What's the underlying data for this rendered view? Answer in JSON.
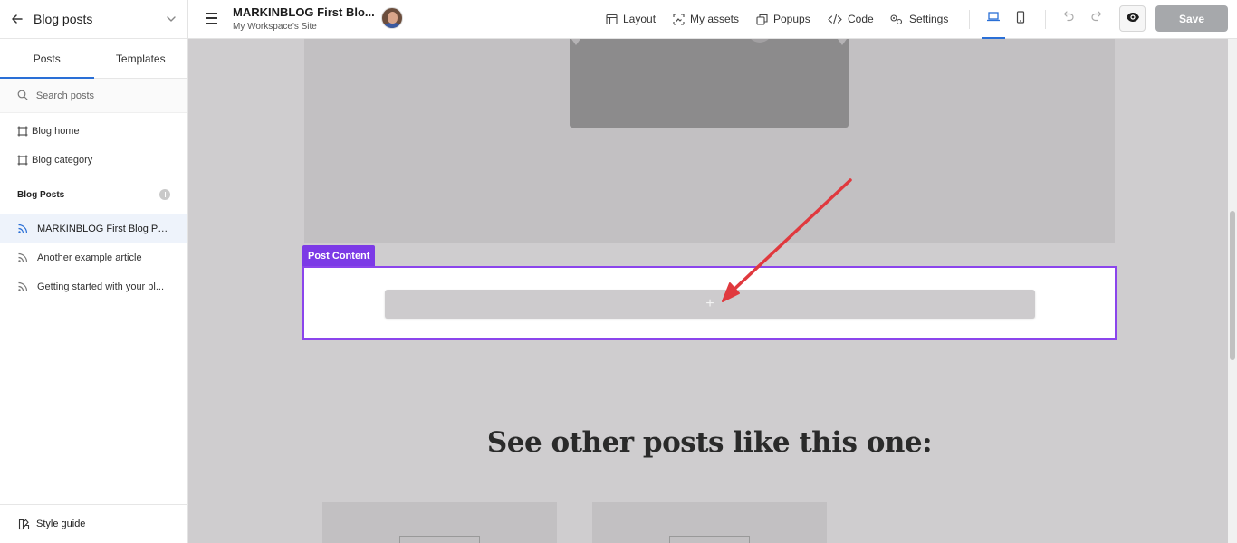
{
  "sidebar": {
    "header_title": "Blog posts",
    "tabs": [
      {
        "label": "Posts"
      },
      {
        "label": "Templates"
      }
    ],
    "search_placeholder": "Search posts",
    "nav_items": [
      {
        "label": "Blog home",
        "icon": "frame-icon"
      },
      {
        "label": "Blog category",
        "icon": "frame-icon"
      }
    ],
    "section_title": "Blog Posts",
    "posts": [
      {
        "label": "MARKINBLOG First Blog Post"
      },
      {
        "label": "Another example article"
      },
      {
        "label": "Getting started with your bl..."
      }
    ],
    "footer_label": "Style guide"
  },
  "topbar": {
    "title": "MARKINBLOG First Blo...",
    "subtitle": "My Workspace's Site",
    "menu": [
      {
        "label": "Layout",
        "icon": "layout-icon"
      },
      {
        "label": "My assets",
        "icon": "assets-icon"
      },
      {
        "label": "Popups",
        "icon": "popups-icon"
      },
      {
        "label": "Code",
        "icon": "code-icon"
      },
      {
        "label": "Settings",
        "icon": "settings-icon"
      }
    ],
    "save_label": "Save"
  },
  "canvas": {
    "post_content_label": "Post Content",
    "add_symbol": "+",
    "heading": "See other posts like this one:"
  },
  "colors": {
    "accent": "#2a6fd6",
    "post_content_border": "#8b45ec",
    "arrow": "#e0393e",
    "save_disabled": "#a6a8ab"
  }
}
